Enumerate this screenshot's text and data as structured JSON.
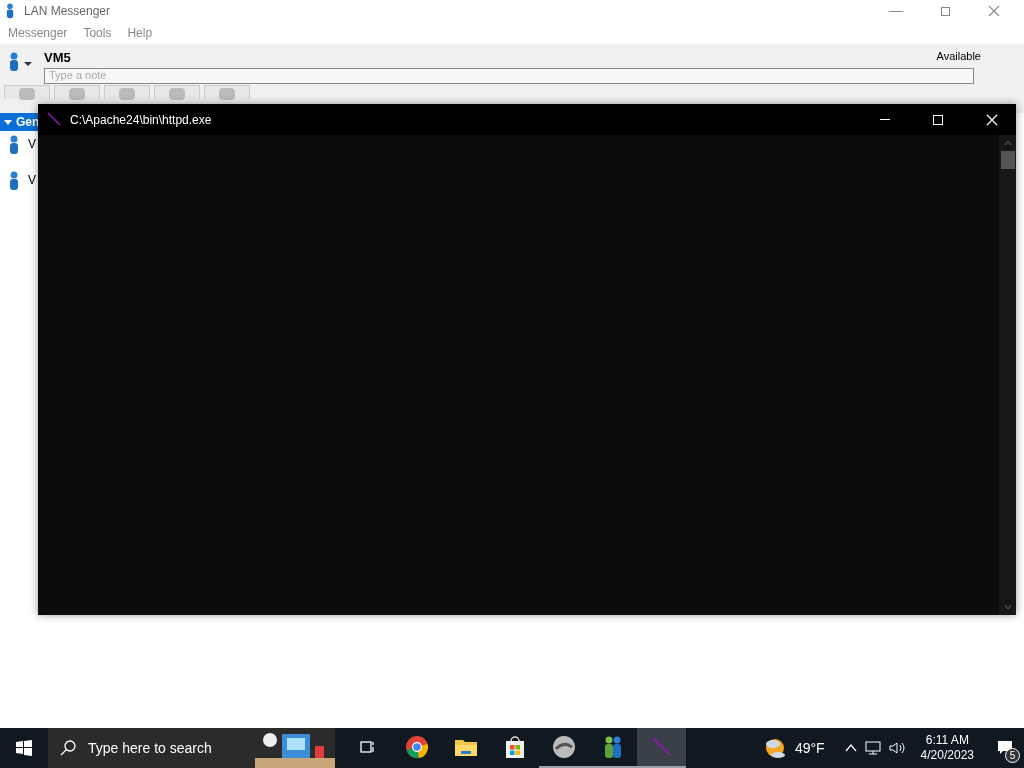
{
  "lan_window": {
    "title": "LAN Messenger",
    "menu": [
      "Messenger",
      "Tools",
      "Help"
    ],
    "profile": {
      "name": "VM5",
      "status": "Available",
      "note_placeholder": "Type a note"
    },
    "group": {
      "label": "Gen",
      "expanded": true
    },
    "contacts": [
      {
        "name": "V"
      },
      {
        "name": "V"
      }
    ]
  },
  "console": {
    "title": "C:\\Apache24\\bin\\httpd.exe"
  },
  "taskbar": {
    "search_placeholder": "Type here to search",
    "apps": [
      {
        "kind": "taskview",
        "running": false,
        "selected": false
      },
      {
        "kind": "chrome",
        "running": false,
        "selected": false
      },
      {
        "kind": "explorer",
        "running": false,
        "selected": false
      },
      {
        "kind": "store",
        "running": false,
        "selected": false
      },
      {
        "kind": "disc",
        "running": true,
        "selected": false
      },
      {
        "kind": "messenger",
        "running": true,
        "selected": false
      },
      {
        "kind": "feather",
        "running": true,
        "selected": true
      }
    ],
    "weather": "49°F",
    "time": "6:11 AM",
    "date": "4/20/2023",
    "notifications": "5"
  }
}
